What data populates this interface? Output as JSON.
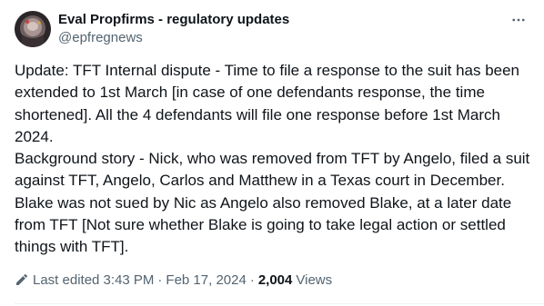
{
  "author": {
    "display_name": "Eval Propfirms - regulatory updates",
    "handle": "@epfregnews",
    "avatar_icon": "profile-avatar"
  },
  "more_icon": "more-horizontal-icon",
  "post": {
    "text": "Update: TFT Internal dispute - Time to file a response to the suit has been extended to 1st March [in case of one defendants response, the time shortened]. All the 4 defendants will file one response before 1st March 2024.\nBackground story - Nick, who was removed from TFT by Angelo, filed a suit against TFT, Angelo, Carlos and Matthew in a Texas court in December. Blake was not sued by Nic as Angelo also removed Blake, at a later date from TFT [Not sure whether Blake is going to take legal action or settled things with TFT]."
  },
  "meta": {
    "edit_icon": "pencil-icon",
    "last_edited": "Last edited 3:43 PM",
    "separator_1": "·",
    "date": "Feb 17, 2024",
    "separator_2": "·",
    "views_count": "2,004",
    "views_label": "Views"
  },
  "colors": {
    "text_primary": "#0f1419",
    "text_secondary": "#536471",
    "divider": "#eff3f4"
  }
}
